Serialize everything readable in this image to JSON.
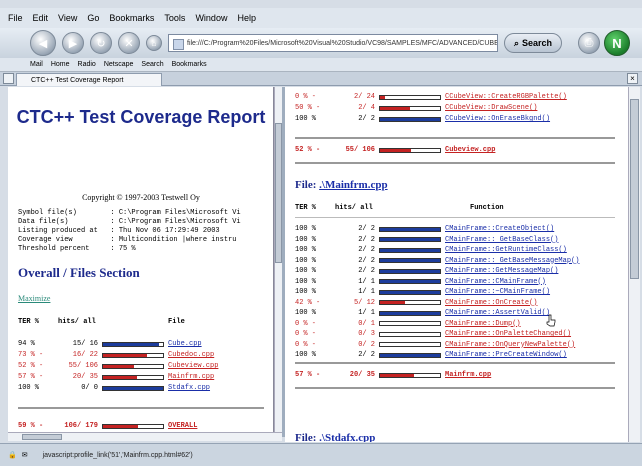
{
  "menu": [
    "File",
    "Edit",
    "View",
    "Go",
    "Bookmarks",
    "Tools",
    "Window",
    "Help"
  ],
  "toolbar": {
    "url": "file:///C:/Program%20Files/Microsoft%20Visual%20Studio/VC98/SAMPLES/MFC/ADVANCED/CUBE/Debu",
    "search_label": "Search",
    "logo_letter": "N"
  },
  "personal_bar": [
    "Mail",
    "Home",
    "Radio",
    "Netscape",
    "Search",
    "Bookmarks"
  ],
  "tab": {
    "label": "CTC++ Test Coverage Report"
  },
  "left": {
    "title": "CTC++ Test Coverage Report",
    "copyright": "Copyright © 1997-2003 Testwell Oy",
    "info": [
      "Symbol file(s)        : C:\\Program Files\\Microsoft Vi",
      "Data file(s)          : C:\\Program Files\\Microsoft Vi",
      "Listing produced at   : Thu Nov 06 17:29:49 2003",
      "Coverage view         : Multicondition |where instru",
      "Threshold percent     : 75 %"
    ],
    "section_title": "Overall / Files Section",
    "maximize": "Maximize",
    "header": {
      "ter": "TER %",
      "hits": "hits/ all",
      "file": "File"
    },
    "files": [
      {
        "pct": "94 %",
        "flag": " ",
        "hits": "15/ 16",
        "frac": 0.94,
        "name": "Cube.cpp",
        "ok": true
      },
      {
        "pct": "73 %",
        "flag": "-",
        "hits": "16/ 22",
        "frac": 0.73,
        "name": "Cubedoc.cpp",
        "ok": false
      },
      {
        "pct": "52 %",
        "flag": "-",
        "hits": "55/ 106",
        "frac": 0.52,
        "name": "Cubeview.cpp",
        "ok": false
      },
      {
        "pct": "57 %",
        "flag": "-",
        "hits": "20/ 35",
        "frac": 0.57,
        "name": "Mainfrm.cpp",
        "ok": false
      },
      {
        "pct": "100 %",
        "flag": " ",
        "hits": "0/ 0",
        "frac": 1.0,
        "name": "Stdafx.cpp",
        "ok": true
      }
    ],
    "overall": {
      "pct": "59 %",
      "flag": "-",
      "hits": "106/ 179",
      "frac": 0.59,
      "name": "OVERALL"
    }
  },
  "right": {
    "top_rows": [
      {
        "pct": "",
        "flag": "",
        "hits": "",
        "frac": 0.0,
        "fn": "",
        "ok": false
      },
      {
        "pct": "0 %",
        "flag": "-",
        "hits": "2/ 24",
        "frac": 0.08,
        "fn": "CCubeView::CreateRGBPalette()",
        "ok": false
      },
      {
        "pct": "50 %",
        "flag": "-",
        "hits": "2/ 4",
        "frac": 0.5,
        "fn": "CCubeView::DrawScene()",
        "ok": false
      },
      {
        "pct": "100 %",
        "flag": " ",
        "hits": "2/ 2",
        "frac": 1.0,
        "fn": "CCubeView::OnEraseBkgnd()",
        "ok": true
      }
    ],
    "cubeview_total": {
      "pct": "52 %",
      "flag": "-",
      "hits": "55/ 106",
      "frac": 0.52,
      "name": "Cubeview.cpp"
    },
    "file1_label": "File:",
    "file1_name": ".\\Mainfrm.cpp",
    "header": {
      "ter": "TER %",
      "hits": "hits/ all",
      "fn": "Function"
    },
    "rows": [
      {
        "pct": "100 %",
        "flag": " ",
        "hits": "2/ 2",
        "frac": 1.0,
        "fn": "CMainFrame::CreateObject()",
        "ok": true
      },
      {
        "pct": "100 %",
        "flag": " ",
        "hits": "2/ 2",
        "frac": 1.0,
        "fn": "CMainFrame:: GetBaseClass()",
        "ok": true
      },
      {
        "pct": "100 %",
        "flag": " ",
        "hits": "2/ 2",
        "frac": 1.0,
        "fn": "CMainFrame::GetRuntimeClass()",
        "ok": true
      },
      {
        "pct": "100 %",
        "flag": " ",
        "hits": "2/ 2",
        "frac": 1.0,
        "fn": "CMainFrame:: GetBaseMessageMap()",
        "ok": true
      },
      {
        "pct": "100 %",
        "flag": " ",
        "hits": "2/ 2",
        "frac": 1.0,
        "fn": "CMainFrame::GetMessageMap()",
        "ok": true
      },
      {
        "pct": "100 %",
        "flag": " ",
        "hits": "1/ 1",
        "frac": 1.0,
        "fn": "CMainFrame::CMainFrame()",
        "ok": true
      },
      {
        "pct": "100 %",
        "flag": " ",
        "hits": "1/ 1",
        "frac": 1.0,
        "fn": "CMainFrame::~CMainFrame()",
        "ok": true
      },
      {
        "pct": "42 %",
        "flag": "-",
        "hits": "5/ 12",
        "frac": 0.42,
        "fn": "CMainFrame::OnCreate()",
        "ok": false
      },
      {
        "pct": "100 %",
        "flag": " ",
        "hits": "1/ 1",
        "frac": 1.0,
        "fn": "CMainFrame::AssertValid()",
        "ok": true
      },
      {
        "pct": "0 %",
        "flag": "-",
        "hits": "0/ 1",
        "frac": 0.0,
        "fn": "CMainFrame::Dump()",
        "ok": false
      },
      {
        "pct": "0 %",
        "flag": "-",
        "hits": "0/ 3",
        "frac": 0.0,
        "fn": "CMainFrame::OnPaletteChanged()",
        "ok": false
      },
      {
        "pct": "0 %",
        "flag": "-",
        "hits": "0/ 2",
        "frac": 0.0,
        "fn": "CMainFrame::OnQueryNewPalette()",
        "ok": false
      },
      {
        "pct": "100 %",
        "flag": " ",
        "hits": "2/ 2",
        "frac": 1.0,
        "fn": "CMainFrame::PreCreateWindow()",
        "ok": true
      }
    ],
    "mainfrm_total": {
      "pct": "57 %",
      "flag": "-",
      "hits": "20/ 35",
      "frac": 0.57,
      "name": "Mainfrm.cpp"
    },
    "file2_label": "File:",
    "file2_name": ".\\Stdafx.cpp"
  },
  "status": {
    "text": "javascript:profile_link('51','Mainfrm.cpp.html#62')"
  },
  "colors": {
    "ok": "#1c3c9c",
    "bad": "#c42222",
    "heading": "#1d2a8c"
  }
}
